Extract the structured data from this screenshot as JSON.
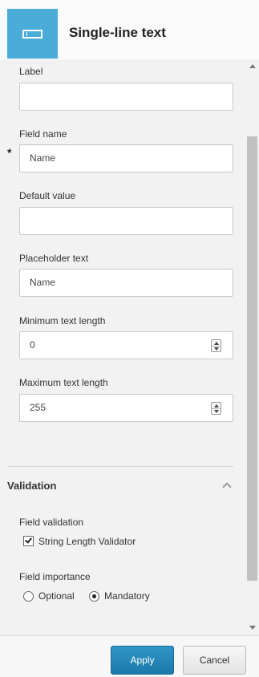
{
  "header": {
    "title": "Single-line text",
    "icon": "text-field-icon",
    "icon_bg": "#4aacd9"
  },
  "fields": {
    "label": {
      "label": "Label",
      "value": ""
    },
    "field_name": {
      "label": "Field name",
      "value": "Name",
      "required_marker": "*"
    },
    "default_value": {
      "label": "Default value",
      "value": ""
    },
    "placeholder_text": {
      "label": "Placeholder text",
      "value": "Name"
    },
    "min_length": {
      "label": "Minimum text length",
      "value": "0"
    },
    "max_length": {
      "label": "Maximum text length",
      "value": "255"
    }
  },
  "validation": {
    "title": "Validation",
    "expanded": true,
    "field_validation_label": "Field validation",
    "validators": [
      {
        "label": "String Length Validator",
        "checked": true
      }
    ],
    "importance_label": "Field importance",
    "importance_options": [
      {
        "label": "Optional",
        "selected": false
      },
      {
        "label": "Mandatory",
        "selected": true
      }
    ]
  },
  "footer": {
    "apply_label": "Apply",
    "cancel_label": "Cancel",
    "apply_color": "#1f86bb"
  }
}
